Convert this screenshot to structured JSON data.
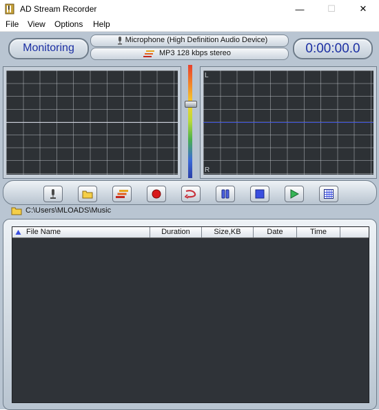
{
  "window": {
    "title": "AD Stream Recorder",
    "minimize_icon": "minimize-icon",
    "maximize_icon": "maximize-icon",
    "close_icon": "close-icon"
  },
  "menu": [
    "File",
    "View",
    "Options",
    "Help"
  ],
  "status": {
    "mode": "Monitoring",
    "timer": "0:00:00.0"
  },
  "input": {
    "device": "Microphone  (High Definition Audio Device)",
    "format": "MP3 128 kbps stereo"
  },
  "scopes": {
    "left_top": "L",
    "left_bottom": "R"
  },
  "toolbar": [
    {
      "name": "microphone-button",
      "icon": "microphone-icon"
    },
    {
      "name": "open-folder-button",
      "icon": "folder-icon"
    },
    {
      "name": "format-button",
      "icon": "format-bars-icon"
    },
    {
      "name": "record-button",
      "icon": "record-icon"
    },
    {
      "name": "repeat-button",
      "icon": "loop-icon"
    },
    {
      "name": "pause-button",
      "icon": "pause-icon"
    },
    {
      "name": "stop-button",
      "icon": "stop-icon"
    },
    {
      "name": "play-button",
      "icon": "play-icon"
    },
    {
      "name": "grid-view-button",
      "icon": "grid-icon"
    }
  ],
  "folder": {
    "path": "C:\\Users\\MLOADS\\Music"
  },
  "list": {
    "columns": [
      "File Name",
      "Duration",
      "Size,KB",
      "Date",
      "Time"
    ]
  },
  "colors": {
    "lcd_text": "#1b2fa3",
    "trace_left": "#c8ccd8",
    "trace_right": "#3b4fd8"
  }
}
